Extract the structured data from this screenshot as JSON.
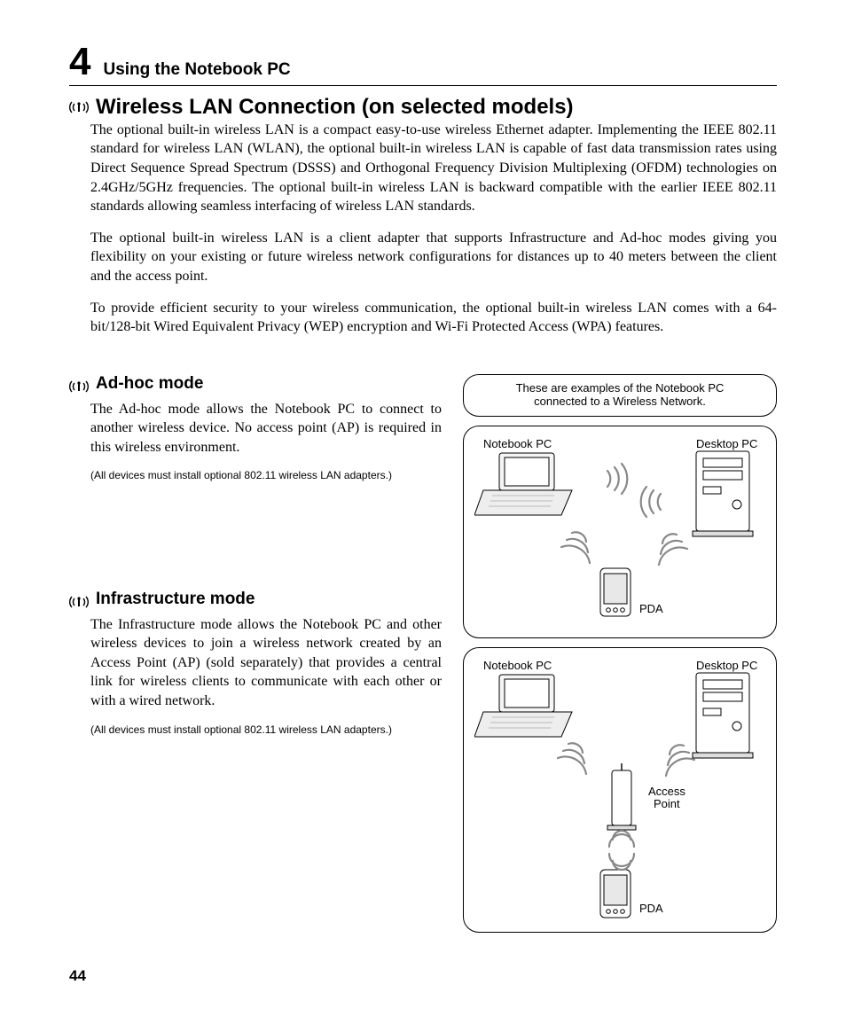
{
  "chapter": {
    "number": "4",
    "title": "Using the Notebook PC"
  },
  "h1": "Wireless LAN Connection (on selected models)",
  "intro": {
    "p1": "The optional built-in wireless LAN is a compact easy-to-use wireless Ethernet adapter. Implementing the IEEE 802.11 standard for wireless LAN (WLAN), the optional built-in wireless LAN is capable of fast data transmission rates using Direct Sequence Spread Spectrum (DSSS) and Orthogonal Frequency Division Multiplexing (OFDM) technologies on 2.4GHz/5GHz frequencies. The optional built-in wireless LAN is backward compatible with the earlier IEEE 802.11 standards allowing seamless interfacing of wireless LAN standards.",
    "p2": "The optional built-in wireless LAN is a client adapter that supports Infrastructure and Ad-hoc modes giving you flexibility on your existing or future wireless network configurations for distances up to 40 meters between the client and the access point.",
    "p3": "To provide efficient security to your wireless communication, the optional built-in wireless LAN comes with a 64-bit/128-bit Wired Equivalent Privacy (WEP) encryption and Wi-Fi Protected Access (WPA) features."
  },
  "adhoc": {
    "title": "Ad-hoc mode",
    "body": "The Ad-hoc mode allows the Notebook PC to connect to another wireless device. No access point (AP) is required in this wireless environment.",
    "note": "(All devices must install optional 802.11 wireless LAN adapters.)"
  },
  "infra": {
    "title": "Infrastructure mode",
    "body": "The Infrastructure mode allows the Notebook PC and other wireless devices to join a wireless network created by an Access Point (AP) (sold separately) that provides a central link for wireless clients to communicate with each other or with a wired network.",
    "note": "(All devices must install optional 802.11 wireless LAN adapters.)"
  },
  "figure_caption": "These are examples of the Notebook PC connected to a Wireless Network.",
  "labels": {
    "notebook": "Notebook PC",
    "desktop": "Desktop PC",
    "pda": "PDA",
    "ap": "Access Point"
  },
  "page_number": "44"
}
